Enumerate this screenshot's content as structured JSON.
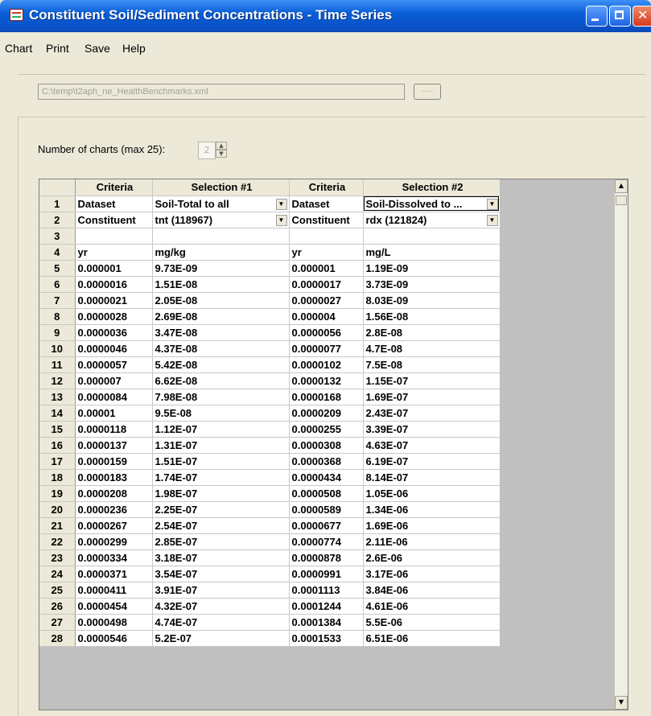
{
  "window": {
    "title": "Constituent Soil/Sediment Concentrations - Time Series"
  },
  "menu": [
    "Chart",
    "Print",
    "Save",
    "Help"
  ],
  "file": {
    "path": "C:\\temp\\t2aph_ne_HealthBenchmarks.xml",
    "browse_label": "....."
  },
  "charts": {
    "label": "Number of charts (max 25):",
    "value": "2"
  },
  "grid": {
    "columns": [
      {
        "number": "",
        "header": ""
      },
      {
        "header": "Criteria"
      },
      {
        "header": "Selection #1"
      },
      {
        "header": "Criteria"
      },
      {
        "header": "Selection #2"
      }
    ],
    "rows": [
      {
        "n": "1",
        "c1": "Dataset",
        "c2": "Soil-Total to all",
        "c3": "Dataset",
        "c4": "Soil-Dissolved to ..."
      },
      {
        "n": "2",
        "c1": "Constituent",
        "c2": "tnt (118967)",
        "c3": "Constituent",
        "c4": "rdx (121824)"
      },
      {
        "n": "3",
        "c1": "",
        "c2": "",
        "c3": "",
        "c4": ""
      },
      {
        "n": "4",
        "c1": "yr",
        "c2": "mg/kg",
        "c3": "yr",
        "c4": "mg/L"
      },
      {
        "n": "5",
        "c1": "0.000001",
        "c2": "9.73E-09",
        "c3": "0.000001",
        "c4": "1.19E-09"
      },
      {
        "n": "6",
        "c1": "0.0000016",
        "c2": "1.51E-08",
        "c3": "0.0000017",
        "c4": "3.73E-09"
      },
      {
        "n": "7",
        "c1": "0.0000021",
        "c2": "2.05E-08",
        "c3": "0.0000027",
        "c4": "8.03E-09"
      },
      {
        "n": "8",
        "c1": "0.0000028",
        "c2": "2.69E-08",
        "c3": "0.000004",
        "c4": "1.56E-08"
      },
      {
        "n": "9",
        "c1": "0.0000036",
        "c2": "3.47E-08",
        "c3": "0.0000056",
        "c4": "2.8E-08"
      },
      {
        "n": "10",
        "c1": "0.0000046",
        "c2": "4.37E-08",
        "c3": "0.0000077",
        "c4": "4.7E-08"
      },
      {
        "n": "11",
        "c1": "0.0000057",
        "c2": "5.42E-08",
        "c3": "0.0000102",
        "c4": "7.5E-08"
      },
      {
        "n": "12",
        "c1": "0.000007",
        "c2": "6.62E-08",
        "c3": "0.0000132",
        "c4": "1.15E-07"
      },
      {
        "n": "13",
        "c1": "0.0000084",
        "c2": "7.98E-08",
        "c3": "0.0000168",
        "c4": "1.69E-07"
      },
      {
        "n": "14",
        "c1": "0.00001",
        "c2": "9.5E-08",
        "c3": "0.0000209",
        "c4": "2.43E-07"
      },
      {
        "n": "15",
        "c1": "0.0000118",
        "c2": "1.12E-07",
        "c3": "0.0000255",
        "c4": "3.39E-07"
      },
      {
        "n": "16",
        "c1": "0.0000137",
        "c2": "1.31E-07",
        "c3": "0.0000308",
        "c4": "4.63E-07"
      },
      {
        "n": "17",
        "c1": "0.0000159",
        "c2": "1.51E-07",
        "c3": "0.0000368",
        "c4": "6.19E-07"
      },
      {
        "n": "18",
        "c1": "0.0000183",
        "c2": "1.74E-07",
        "c3": "0.0000434",
        "c4": "8.14E-07"
      },
      {
        "n": "19",
        "c1": "0.0000208",
        "c2": "1.98E-07",
        "c3": "0.0000508",
        "c4": "1.05E-06"
      },
      {
        "n": "20",
        "c1": "0.0000236",
        "c2": "2.25E-07",
        "c3": "0.0000589",
        "c4": "1.34E-06"
      },
      {
        "n": "21",
        "c1": "0.0000267",
        "c2": "2.54E-07",
        "c3": "0.0000677",
        "c4": "1.69E-06"
      },
      {
        "n": "22",
        "c1": "0.0000299",
        "c2": "2.85E-07",
        "c3": "0.0000774",
        "c4": "2.11E-06"
      },
      {
        "n": "23",
        "c1": "0.0000334",
        "c2": "3.18E-07",
        "c3": "0.0000878",
        "c4": "2.6E-06"
      },
      {
        "n": "24",
        "c1": "0.0000371",
        "c2": "3.54E-07",
        "c3": "0.0000991",
        "c4": "3.17E-06"
      },
      {
        "n": "25",
        "c1": "0.0000411",
        "c2": "3.91E-07",
        "c3": "0.0001113",
        "c4": "3.84E-06"
      },
      {
        "n": "26",
        "c1": "0.0000454",
        "c2": "4.32E-07",
        "c3": "0.0001244",
        "c4": "4.61E-06"
      },
      {
        "n": "27",
        "c1": "0.0000498",
        "c2": "4.74E-07",
        "c3": "0.0001384",
        "c4": "5.5E-06"
      },
      {
        "n": "28",
        "c1": "0.0000546",
        "c2": "5.2E-07",
        "c3": "0.0001533",
        "c4": "6.51E-06"
      }
    ]
  }
}
